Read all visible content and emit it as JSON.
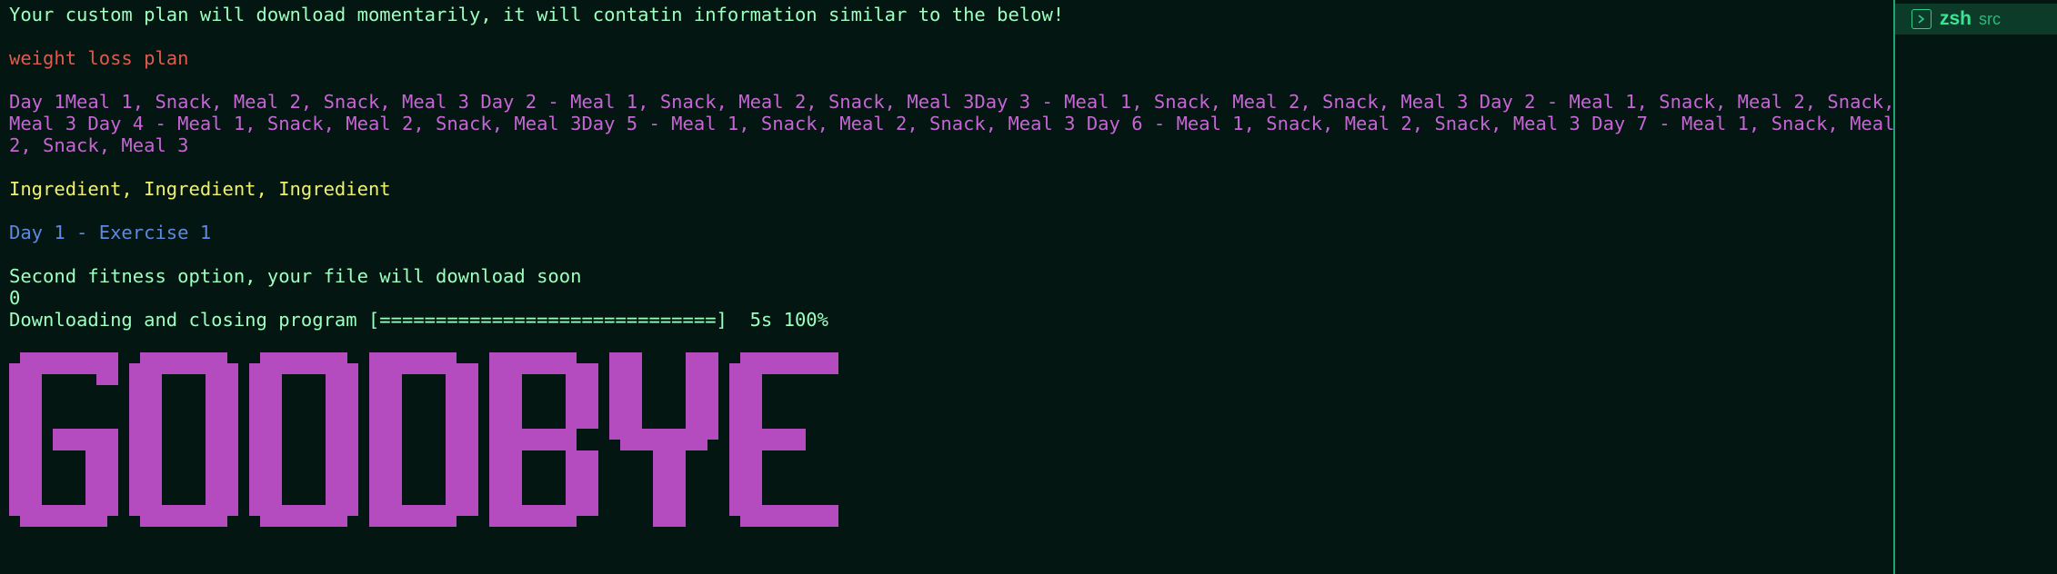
{
  "terminal": {
    "lines": [
      {
        "text": "Your custom plan will download momentarily, it will contatin information similar to the below!",
        "color": "#9dffc0"
      },
      {
        "text": "weight loss plan",
        "color": "#e05a4e"
      },
      {
        "text": "Day 1Meal 1, Snack, Meal 2, Snack, Meal 3 Day 2 - Meal 1, Snack, Meal 2, Snack, Meal 3Day 3 - Meal 1, Snack, Meal 2, Snack, Meal 3 Day 2 - Meal 1, Snack, Meal 2, Snack,",
        "color": "#c566d4"
      },
      {
        "text": "Meal 3 Day 4 - Meal 1, Snack, Meal 2, Snack, Meal 3Day 5 - Meal 1, Snack, Meal 2, Snack, Meal 3 Day 6 - Meal 1, Snack, Meal 2, Snack, Meal 3 Day 7 - Meal 1, Snack, Meal",
        "color": "#c566d4"
      },
      {
        "text": "2, Snack, Meal 3",
        "color": "#c566d4"
      },
      {
        "text": "Ingredient, Ingredient, Ingredient",
        "color": "#f0f070"
      },
      {
        "text": "Day 1 - Exercise 1",
        "color": "#5b8be0"
      },
      {
        "text": "Second fitness option, your file will download soon",
        "color": "#9dffc0"
      },
      {
        "text": "0",
        "color": "#9dffc0"
      },
      {
        "text": "Downloading and closing program [==============================]  5s 100%",
        "color": "#9dffc0"
      }
    ],
    "progress": {
      "percent": 100,
      "elapsed": "5s"
    },
    "banner_text": "GOODBYE",
    "banner_color": "#b44bbf"
  },
  "side_panel": {
    "tab_title": "zsh",
    "tab_subtitle": "src",
    "icon": "terminal-icon",
    "accent": "#3ce596"
  }
}
